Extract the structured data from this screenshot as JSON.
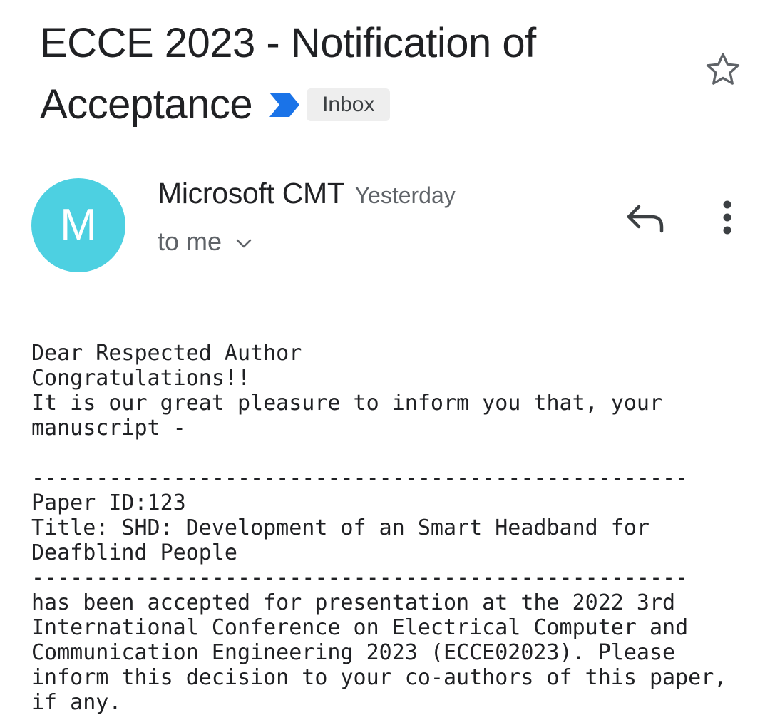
{
  "subject": {
    "line1": "ECCE 2023 - Notification of",
    "line2": "Acceptance",
    "label": "Inbox"
  },
  "sender": {
    "avatar_letter": "M",
    "name": "Microsoft CMT",
    "time": "Yesterday",
    "recipient": "to me"
  },
  "icons": {
    "star": "star-outline-icon",
    "importance": "importance-marker-icon",
    "reply": "reply-icon",
    "more": "more-vert-icon",
    "expand": "chevron-down-icon"
  },
  "colors": {
    "avatar": "#4dd0e1",
    "importance_marker": "#1a73e8",
    "label_chip_bg": "#eeeeee",
    "secondary_text": "#5f6368"
  },
  "body": {
    "lines": [
      "Dear Respected Author",
      "Congratulations!!",
      "It is our great pleasure to inform you that, your",
      "manuscript -",
      "",
      "---------------------------------------------------",
      "Paper ID:123",
      "Title: SHD: Development of an Smart Headband for",
      "Deafblind People",
      "---------------------------------------------------",
      "has been accepted for presentation at the 2022 3rd",
      "International Conference on Electrical Computer and",
      "Communication Engineering 2023 (ECCE02023). Please",
      "inform this decision to your co-authors of this paper,",
      "if any."
    ]
  }
}
